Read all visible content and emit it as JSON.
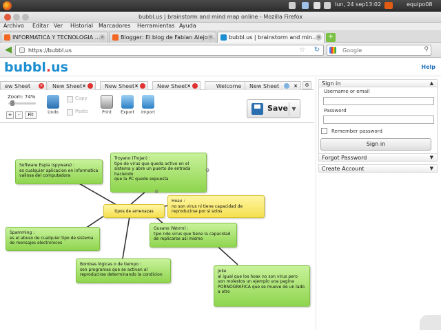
{
  "system_panel": {
    "date": "lun, 24 sep",
    "time": "13:02",
    "user": "equipo08"
  },
  "window": {
    "title": "bubbl.us | brainstorm and mind map online - Mozilla Firefox"
  },
  "menu": [
    "Archivo",
    "Editar",
    "Ver",
    "Historial",
    "Marcadores",
    "Herramientas",
    "Ayuda"
  ],
  "browser_tabs": [
    {
      "label": "INFORMATICA Y TECNOLOGIA ...",
      "color": "#f26522"
    },
    {
      "label": "Blogger: El blog de Fabian Alejo -...",
      "color": "#f26522"
    },
    {
      "label": "bubbl.us | brainstorm and min...",
      "color": "#1d8ed1"
    }
  ],
  "nav": {
    "url": "https://bubbl.us",
    "search_placeholder": "Google"
  },
  "site": {
    "logo_text": "bubbl",
    "logo_dot": ".",
    "logo_tld": "us",
    "help": "Help"
  },
  "sheet_tabs": [
    {
      "label": "ew Sheet"
    },
    {
      "label": "New Sheet"
    },
    {
      "label": "New Sheet"
    },
    {
      "label": "New Sheet"
    },
    {
      "label": "Welcome"
    },
    {
      "label": "New Sheet"
    }
  ],
  "toolbar": {
    "zoom_label": "Zoom: 74%",
    "zoom_fraction": 0.15,
    "plus": "+",
    "minus": "-",
    "fit": "Fit",
    "undo": "Undo",
    "copy": "Copy",
    "paste": "Paste",
    "print": "Print",
    "export": "Export",
    "import": "Import",
    "save": "Save"
  },
  "mindmap": {
    "center": "tipos de amenazas",
    "nodes": [
      {
        "id": "spyware",
        "color": "green",
        "text": "Software Espia (spyware) :\nes cualquier aplicacion en informatica\nvaliosa del computadora"
      },
      {
        "id": "troyano",
        "color": "green",
        "text": "Troyano (Trojan) :\ntipo de virus que queda activo en el\nsistema y abre un puerto de entrada\nhaciendo\nque la PC quede expuesta"
      },
      {
        "id": "hoax",
        "color": "yellow",
        "text": "Hoax :\nno son virus ni tiene capacidad de\nreproducirse por si solos"
      },
      {
        "id": "spamming",
        "color": "green",
        "text": "Spamming :\nes el abuso de cualquier tipo de sistema\nde mensajes electronicos"
      },
      {
        "id": "gusano",
        "color": "green",
        "text": "Gusano (Worm) :\ntipo nde virus que tiene la capacidad\nde replicarse asi mismo"
      },
      {
        "id": "bombas",
        "color": "green",
        "text": "Bombas lógicas o de tiempo :\nson programas que se activan al\nreproducirse determinando la condicion"
      },
      {
        "id": "joke",
        "color": "green",
        "text": "Joke\nal igual que los hoax no son virus pero\nson molestos un ejemplo  una pagina\nPORNOGRAFICA  que se mueve de un lado\na otro"
      }
    ]
  },
  "sidebar": {
    "sign_in": "Sign in",
    "username_label": "Username or email",
    "password_label": "Password",
    "remember": "Remember password",
    "sign_in_button": "Sign in",
    "forgot": "Forgot Password",
    "create": "Create Account"
  }
}
